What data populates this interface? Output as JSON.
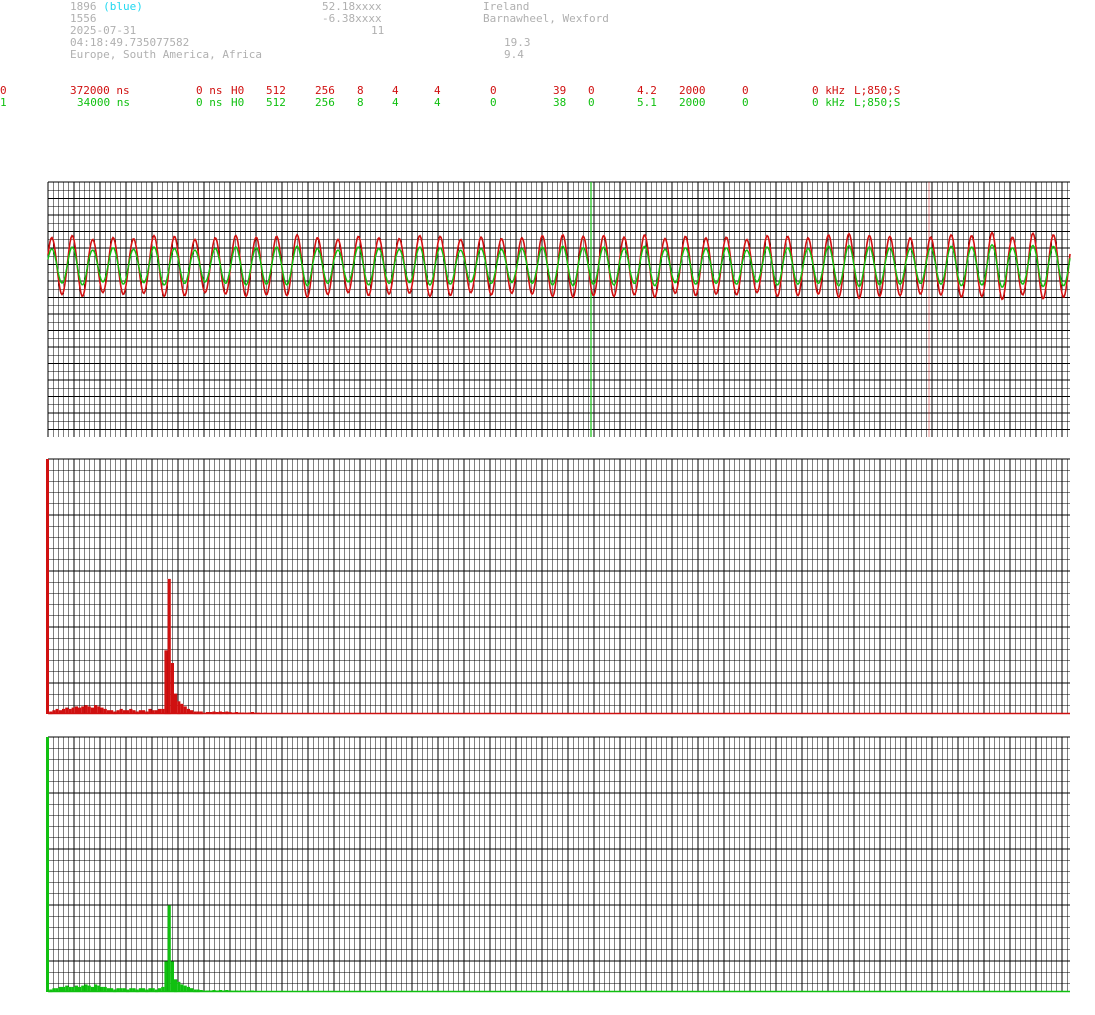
{
  "header": {
    "id_line": "1896",
    "id_color_label": "(blue)",
    "line2": "1556",
    "date": "2025-07-31",
    "time": "04:18:49.735077582",
    "region": "Europe, South America, Africa",
    "lat": "52.18xxxx",
    "lon": "-6.38xxxx",
    "num": "11",
    "country": "Ireland",
    "place": "Barnawheel, Wexford",
    "val1": "19.3",
    "val2": "9.4"
  },
  "channels": [
    {
      "idx": "0",
      "t1": "372000 ns",
      "t2": "0 ns",
      "mode": "H0",
      "a": "512",
      "b": "256",
      "c": "8",
      "d": "4",
      "e": "4",
      "f": "0",
      "g": "39",
      "h": "0",
      "i": "4.2",
      "j": "2000",
      "k": "0",
      "l": "0 kHz",
      "m": "L;850;S",
      "color": "#d01010"
    },
    {
      "idx": "1",
      "t1": "34000 ns",
      "t2": "0 ns",
      "mode": "H0",
      "a": "512",
      "b": "256",
      "c": "8",
      "d": "4",
      "e": "4",
      "f": "0",
      "g": "38",
      "h": "0",
      "i": "5.1",
      "j": "2000",
      "k": "0",
      "l": "0 kHz",
      "m": "L;850;S",
      "color": "#10c010"
    }
  ],
  "chart_data": [
    {
      "type": "line",
      "series": [
        {
          "color": "#d01010",
          "amplitudes": [
            0.75,
            0.8,
            0.7,
            0.75,
            0.72,
            0.8,
            0.78,
            0.7,
            0.74,
            0.8,
            0.76,
            0.78,
            0.82,
            0.75,
            0.7,
            0.78,
            0.74,
            0.72,
            0.8,
            0.78,
            0.7,
            0.76,
            0.72,
            0.74,
            0.8,
            0.82,
            0.78,
            0.8,
            0.76,
            0.82,
            0.72,
            0.78,
            0.74,
            0.76,
            0.7,
            0.8,
            0.78,
            0.74,
            0.82,
            0.85,
            0.8,
            0.78,
            0.74,
            0.76,
            0.82,
            0.8,
            0.88,
            0.76,
            0.86,
            0.82
          ]
        },
        {
          "color": "#10c010",
          "amplitudes": [
            0.45,
            0.5,
            0.42,
            0.48,
            0.44,
            0.5,
            0.46,
            0.42,
            0.46,
            0.5,
            0.48,
            0.5,
            0.52,
            0.46,
            0.42,
            0.5,
            0.46,
            0.44,
            0.5,
            0.48,
            0.42,
            0.46,
            0.44,
            0.46,
            0.5,
            0.52,
            0.48,
            0.5,
            0.46,
            0.52,
            0.44,
            0.48,
            0.46,
            0.48,
            0.42,
            0.5,
            0.48,
            0.46,
            0.52,
            0.54,
            0.5,
            0.48,
            0.46,
            0.48,
            0.52,
            0.5,
            0.56,
            0.48,
            0.54,
            0.52
          ]
        }
      ]
    },
    {
      "type": "bar",
      "color": "#d01010",
      "values": [
        1.0,
        0.01,
        0.015,
        0.02,
        0.015,
        0.02,
        0.025,
        0.02,
        0.025,
        0.03,
        0.025,
        0.03,
        0.035,
        0.03,
        0.025,
        0.035,
        0.03,
        0.025,
        0.02,
        0.015,
        0.015,
        0.01,
        0.015,
        0.02,
        0.015,
        0.015,
        0.02,
        0.015,
        0.01,
        0.015,
        0.015,
        0.01,
        0.02,
        0.015,
        0.015,
        0.02,
        0.02,
        0.25,
        0.53,
        0.2,
        0.08,
        0.05,
        0.04,
        0.03,
        0.02,
        0.015,
        0.01,
        0.01,
        0.01,
        0.005,
        0.008,
        0.008,
        0.01,
        0.008,
        0.01,
        0.008,
        0.01,
        0.008,
        0.006,
        0.008,
        0.006,
        0.006,
        0.005,
        0.006,
        0.008,
        0.005,
        0.005,
        0.004,
        0.005,
        0.004
      ]
    },
    {
      "type": "bar",
      "color": "#10c010",
      "values": [
        1.0,
        0.01,
        0.015,
        0.015,
        0.02,
        0.02,
        0.025,
        0.02,
        0.02,
        0.025,
        0.02,
        0.025,
        0.03,
        0.025,
        0.02,
        0.03,
        0.025,
        0.02,
        0.02,
        0.015,
        0.015,
        0.01,
        0.015,
        0.015,
        0.015,
        0.01,
        0.015,
        0.015,
        0.01,
        0.015,
        0.015,
        0.01,
        0.015,
        0.015,
        0.01,
        0.015,
        0.02,
        0.12,
        0.34,
        0.12,
        0.05,
        0.04,
        0.03,
        0.025,
        0.02,
        0.015,
        0.01,
        0.01,
        0.008,
        0.005,
        0.006,
        0.006,
        0.008,
        0.006,
        0.008,
        0.006,
        0.008,
        0.006,
        0.005,
        0.006,
        0.005,
        0.005,
        0.004,
        0.005,
        0.006,
        0.004,
        0.004,
        0.004,
        0.004,
        0.004
      ]
    }
  ]
}
